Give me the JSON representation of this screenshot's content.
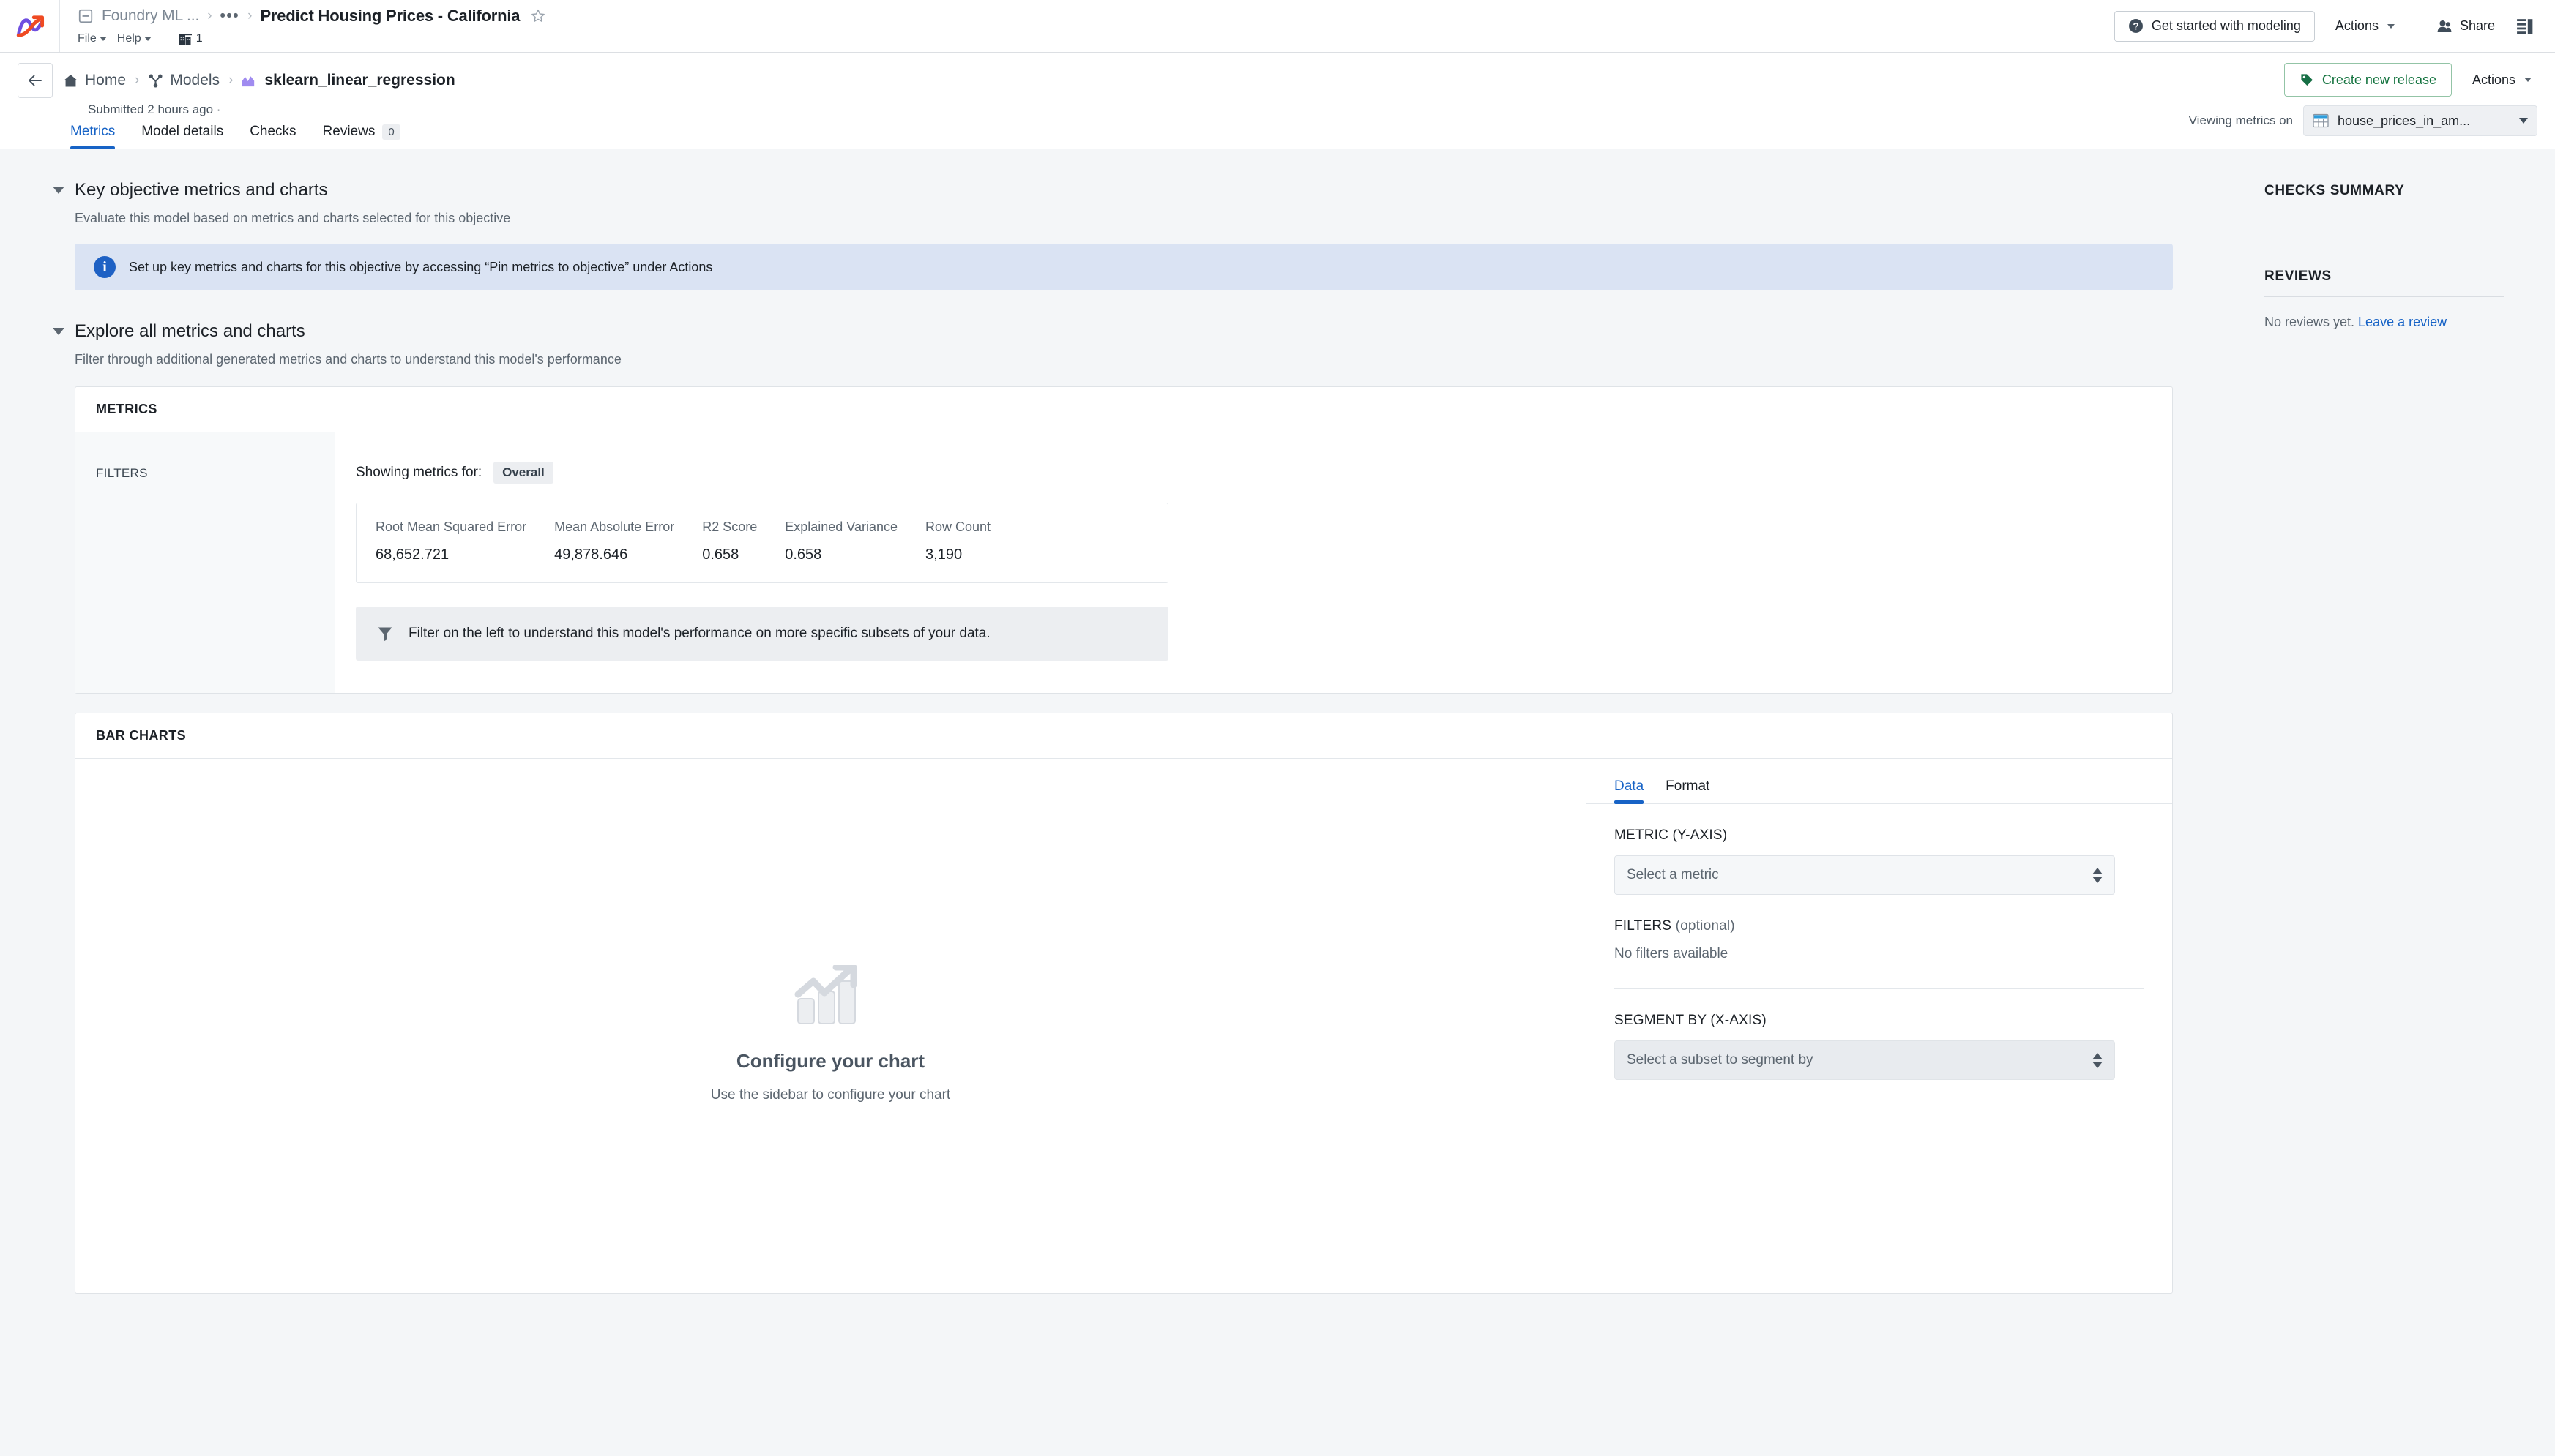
{
  "topbar": {
    "logo_name": "foundry-logo",
    "breadcrumb_project": "Foundry ML ...",
    "breadcrumb_ellipsis": "•••",
    "breadcrumb_sep": "›",
    "document_title": "Predict Housing Prices - California",
    "menus": [
      {
        "label": "File"
      },
      {
        "label": "Help"
      }
    ],
    "org_count": "1",
    "get_started_label": "Get started with modeling",
    "actions_label": "Actions",
    "share_label": "Share"
  },
  "subheader": {
    "breadcrumbs": [
      {
        "label": "Home",
        "icon": "home-icon"
      },
      {
        "label": "Models",
        "icon": "models-icon"
      },
      {
        "label": "sklearn_linear_regression",
        "icon": "model-icon"
      }
    ],
    "separator": "›",
    "submitted": "Submitted 2 hours ago ·",
    "create_release_label": "Create new release",
    "actions_label": "Actions",
    "viewing_label": "Viewing metrics on",
    "dataset_name": "house_prices_in_am..."
  },
  "tabs": [
    {
      "label": "Metrics",
      "active": true,
      "badge": ""
    },
    {
      "label": "Model details",
      "active": false,
      "badge": ""
    },
    {
      "label": "Checks",
      "active": false,
      "badge": ""
    },
    {
      "label": "Reviews",
      "active": false,
      "badge": "0"
    }
  ],
  "key_objective": {
    "title": "Key objective metrics and charts",
    "subtitle": "Evaluate this model based on metrics and charts selected for this objective",
    "callout": "Set up key metrics and charts for this objective by accessing “Pin metrics to objective” under Actions"
  },
  "explore": {
    "title": "Explore all metrics and charts",
    "subtitle": "Filter through additional generated metrics and charts to understand this model's performance"
  },
  "metrics_card": {
    "header": "METRICS",
    "filters_label": "FILTERS",
    "showing_label": "Showing metrics for:",
    "showing_badge": "Overall",
    "filter_hint": "Filter on the left to understand this model's performance on more specific subsets of your data."
  },
  "chart_data": {
    "type": "table",
    "title": "Overall metrics",
    "columns": [
      "Root Mean Squared Error",
      "Mean Absolute Error",
      "R2 Score",
      "Explained Variance",
      "Row Count"
    ],
    "rows": [
      [
        "68,652.721",
        "49,878.646",
        "0.658",
        "0.658",
        "3,190"
      ]
    ],
    "values": [
      68652.721,
      49878.646,
      0.658,
      0.658,
      3190
    ]
  },
  "bar_charts_card": {
    "header": "BAR CHARTS",
    "empty_state": {
      "icon": "bar-chart-trend-icon",
      "title": "Configure your chart",
      "subtitle": "Use the sidebar to configure your chart"
    },
    "config_tabs": [
      {
        "label": "Data",
        "active": true
      },
      {
        "label": "Format",
        "active": false
      }
    ],
    "metric_label": "METRIC (Y-AXIS)",
    "metric_placeholder": "Select a metric",
    "filters_label": "FILTERS",
    "filters_optional": " (optional)",
    "filters_empty": "No filters available",
    "segment_label": "SEGMENT BY (X-AXIS)",
    "segment_placeholder": "Select a subset to segment by"
  },
  "right_panel": {
    "checks_summary_title": "CHECKS SUMMARY",
    "reviews_title": "REVIEWS",
    "no_reviews_text": "No reviews yet. ",
    "leave_review_link": "Leave a review"
  },
  "colors": {
    "accent_blue": "#1763c6",
    "release_green": "#14733f",
    "info_bg": "#dae3f3",
    "info_icon": "#1e61c4",
    "page_bg": "#f4f6f8",
    "model_purple": "#a08bf0"
  }
}
